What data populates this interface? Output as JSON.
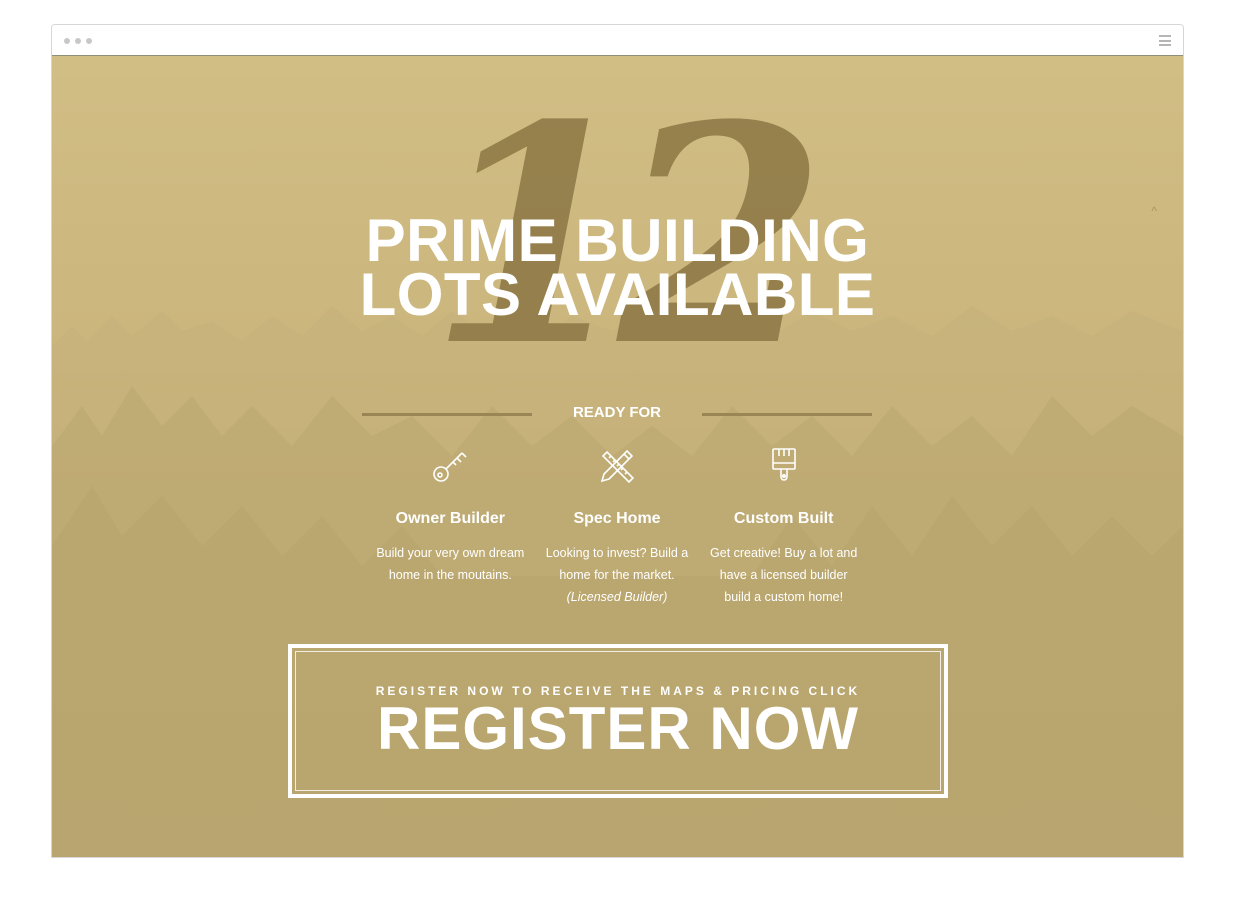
{
  "browser": {
    "window_dots": 3,
    "menu_icon": "hamburger-icon"
  },
  "hero": {
    "big_number": "12",
    "headline_line1": "PRIME BUILDING",
    "headline_line2": "LOTS AVAILABLE",
    "ready_label": "READY FOR",
    "scroll_up_icon": "chevron-up-icon",
    "scroll_up_glyph": "^",
    "colors": {
      "background": "#cbb67d",
      "number": "#937e4b",
      "text": "#ffffff"
    }
  },
  "features": [
    {
      "icon": "key-icon",
      "title": "Owner Builder",
      "desc": "Build your very own dream home in the moutains.",
      "note": ""
    },
    {
      "icon": "pencil-ruler-icon",
      "title": "Spec Home",
      "desc": "Looking to invest? Build a home for the market.",
      "note": "(Licensed Builder)"
    },
    {
      "icon": "paint-brush-icon",
      "title": "Custom Built",
      "desc": "Get creative! Buy a lot and have a licensed builder build a custom home!",
      "note": ""
    }
  ],
  "cta": {
    "small": "REGISTER NOW TO RECEIVE THE MAPS & PRICING CLICK",
    "big": "REGISTER NOW"
  }
}
